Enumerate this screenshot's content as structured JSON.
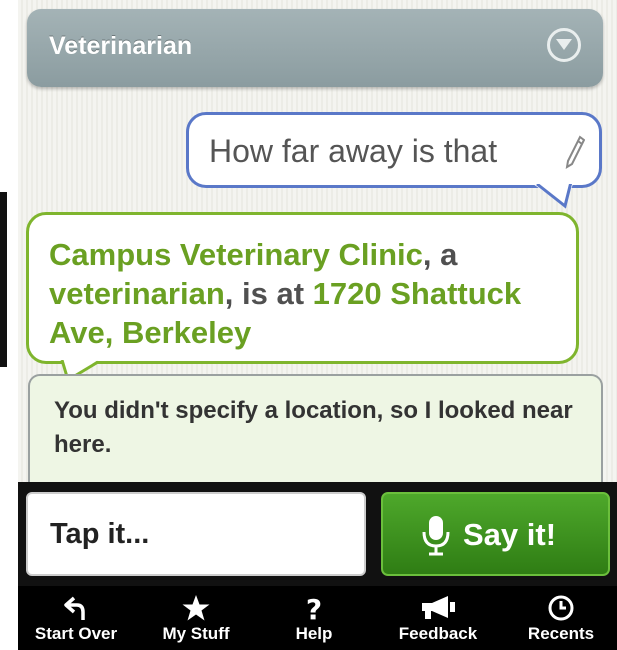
{
  "category": {
    "label": "Veterinarian",
    "toggle_icon": "chevron-down-icon"
  },
  "conversation": {
    "user_query": "How far away is that",
    "edit_icon": "pencil-icon",
    "answer": {
      "place_name": "Campus Veterinary Clinic",
      "sep1": ", a ",
      "category": "veterinarian",
      "sep2": ", is at ",
      "address": "1720 Shattuck Ave, Berkeley"
    },
    "note": "You didn't specify a location, so I looked near here."
  },
  "input": {
    "tap_label": "Tap it...",
    "say_label": "Say it!",
    "mic_icon": "microphone-icon"
  },
  "tabs": [
    {
      "label": "Start Over",
      "icon": "undo-icon"
    },
    {
      "label": "My Stuff",
      "icon": "star-icon"
    },
    {
      "label": "Help",
      "icon": "question-icon"
    },
    {
      "label": "Feedback",
      "icon": "megaphone-icon"
    },
    {
      "label": "Recents",
      "icon": "clock-icon"
    }
  ],
  "colors": {
    "accent_green": "#6aa022",
    "bubble_border_blue": "#5a78c8",
    "say_button_green": "#3d9420"
  }
}
